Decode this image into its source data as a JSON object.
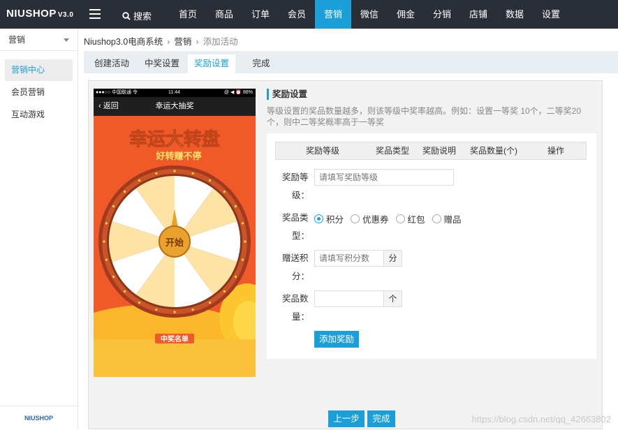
{
  "brand": {
    "name": "NIUSHOP",
    "version": "V3.0"
  },
  "topbar": {
    "search_label": "搜索",
    "nav": [
      "首页",
      "商品",
      "订单",
      "会员",
      "营销",
      "微信",
      "佣金",
      "分销",
      "店铺",
      "数据",
      "设置"
    ],
    "active_nav": "营销"
  },
  "sidebar": {
    "header": "营销",
    "items": [
      {
        "label": "营销中心",
        "active": true
      },
      {
        "label": "会员营销",
        "active": false
      },
      {
        "label": "互动游戏",
        "active": false
      }
    ],
    "footer_logo": "NIUSHOP"
  },
  "breadcrumb": [
    "Niushop3.0电商系统",
    "营销",
    "添加活动"
  ],
  "tabs": [
    {
      "label": "创建活动",
      "active": false
    },
    {
      "label": "中奖设置",
      "active": false
    },
    {
      "label": "奖励设置",
      "active": true
    },
    {
      "label": "完成",
      "active": false
    }
  ],
  "phone": {
    "status_left": "●●●○○ 中国联通 令",
    "status_time": "11:44",
    "status_right": "@ ◀ ⏰ 88%",
    "back_label": "返回",
    "title": "幸运大抽奖",
    "banner_main": "幸运大转盘",
    "banner_sub": "好转赚不停",
    "start_label": "开始",
    "winners_label": "中奖名单"
  },
  "settings": {
    "title": "奖励设置",
    "description": "等级设置的奖品数量越多，则该等级中奖率越高。例如：设置一等奖 10个，二等奖20个，则中二等奖概率高于一等奖",
    "table_headers": [
      "奖励等级",
      "奖品类型",
      "奖励说明",
      "奖品数量(个)",
      "操作"
    ],
    "form": {
      "level_label_1": "奖励等",
      "level_label_2": "级：",
      "level_placeholder": "请填写奖励等级",
      "type_label_1": "奖品类",
      "type_label_2": "型：",
      "type_options": [
        {
          "label": "积分",
          "checked": true
        },
        {
          "label": "优惠券",
          "checked": false
        },
        {
          "label": "红包",
          "checked": false
        },
        {
          "label": "赠品",
          "checked": false
        }
      ],
      "points_label_1": "赠送积",
      "points_label_2": "分：",
      "points_placeholder": "请填写积分数",
      "points_unit": "分",
      "qty_label_1": "奖品数",
      "qty_label_2": "量：",
      "qty_value": "",
      "qty_unit": "个",
      "add_button": "添加奖励"
    }
  },
  "footer": {
    "prev_button": "上一步",
    "finish_button": "完成"
  },
  "watermark": "https://blog.csdn.net/qq_42663802",
  "colors": {
    "accent": "#1a9fd9",
    "topbar": "#2a2f37",
    "phone_bg": "#f05a28",
    "wheel_rim": "#a23a1c",
    "wheel_light": "#fde4a6"
  }
}
